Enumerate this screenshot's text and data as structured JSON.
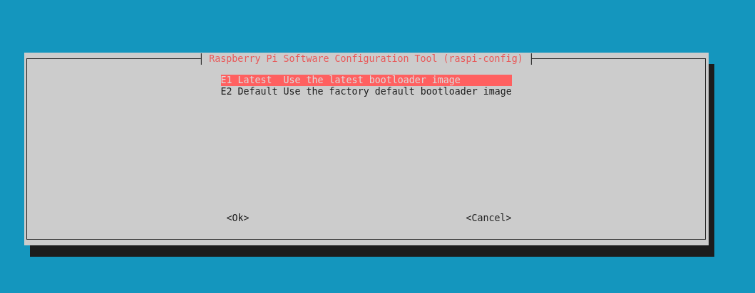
{
  "dialog": {
    "title": "Raspberry Pi Software Configuration Tool (raspi-config)",
    "menu_items": [
      {
        "tag": "E1 Latest ",
        "description": "Use the latest bootloader image",
        "selected": true
      },
      {
        "tag": "E2 Default",
        "description": "Use the factory default bootloader image",
        "selected": false
      }
    ],
    "buttons": [
      "<Ok>",
      "<Cancel>"
    ]
  }
}
